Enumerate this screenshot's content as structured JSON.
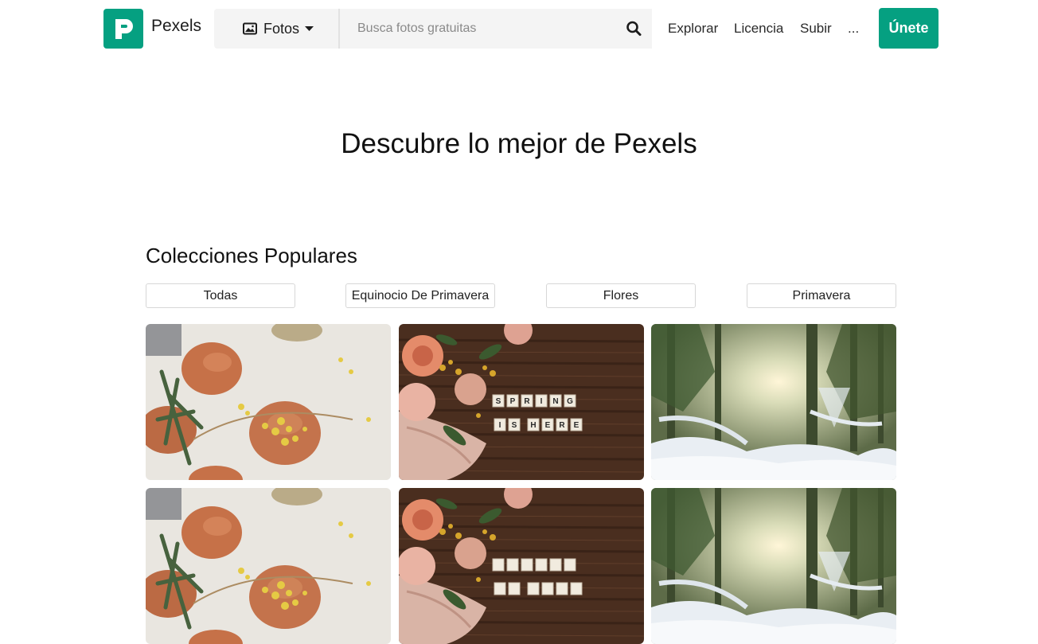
{
  "header": {
    "brand": "Pexels",
    "media_type": "Fotos",
    "search_placeholder": "Busca fotos gratuitas",
    "nav": [
      "Explorar",
      "Licencia",
      "Subir"
    ],
    "more": "...",
    "join": "Únete"
  },
  "hero": {
    "title": "Descubre lo mejor de Pexels"
  },
  "collections": {
    "title": "Colecciones Populares",
    "filters": [
      "Todas",
      "Equinocio De Primavera",
      "Flores",
      "Primavera"
    ]
  },
  "spring_tiles": [
    "S",
    "P",
    "R",
    "I",
    "N",
    "G",
    "I",
    "S",
    "H",
    "E",
    "R",
    "E"
  ],
  "colors": {
    "brand": "#05a081"
  }
}
